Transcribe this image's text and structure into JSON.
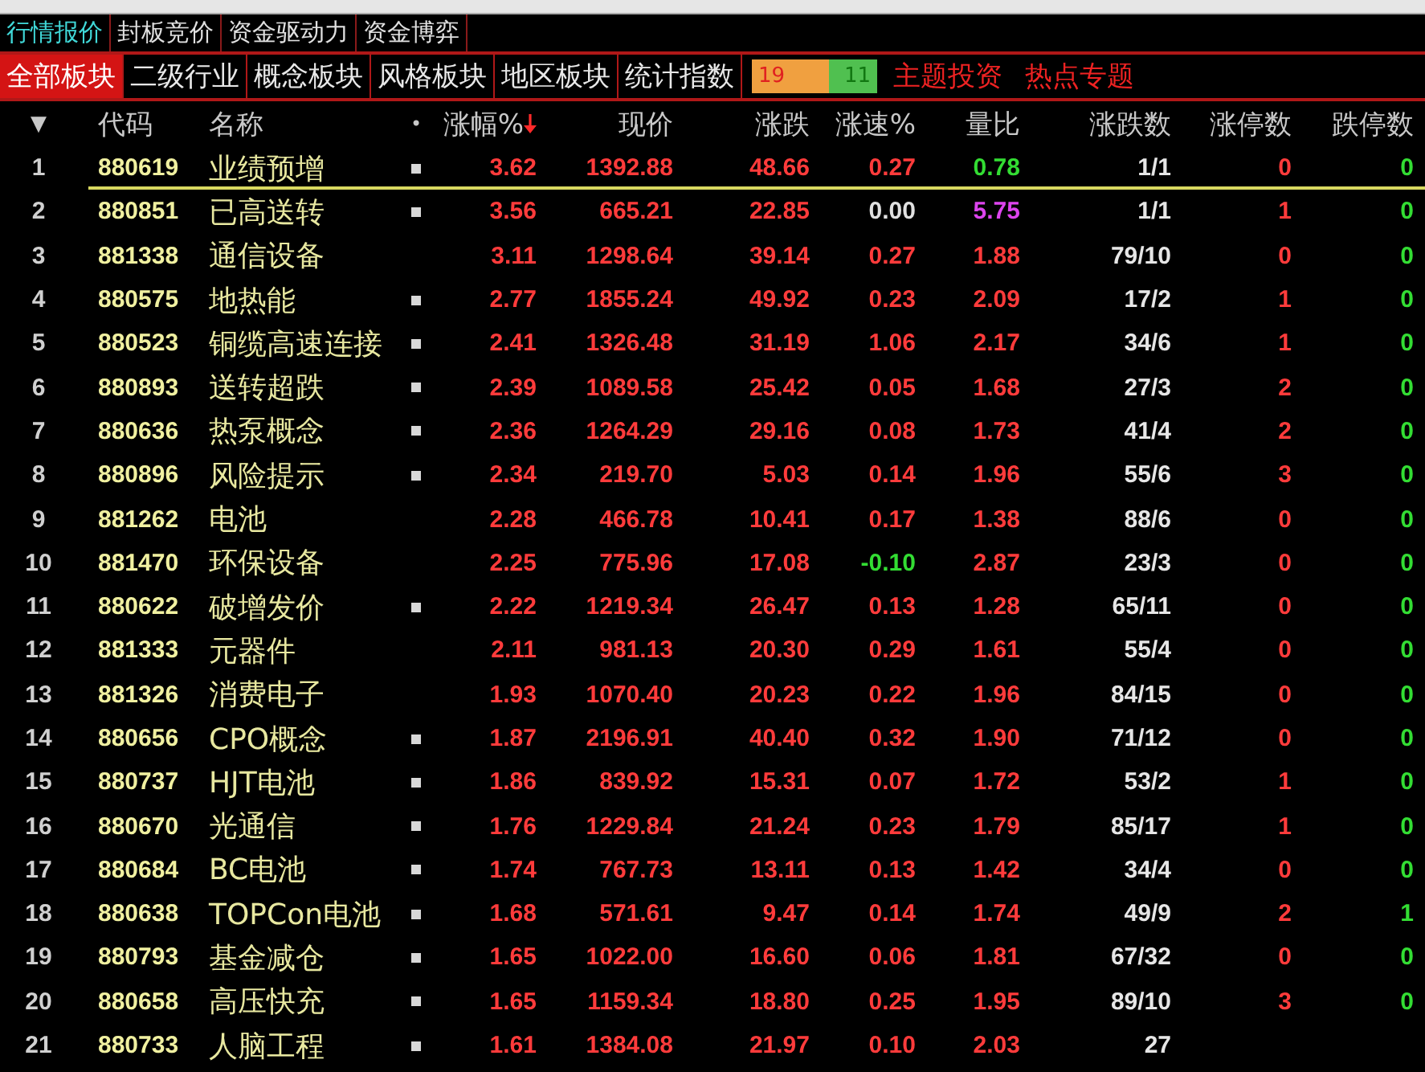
{
  "top_tabs": [
    {
      "label": "行情报价",
      "selected": true
    },
    {
      "label": "封板竞价",
      "selected": false
    },
    {
      "label": "资金驱动力",
      "selected": false
    },
    {
      "label": "资金博弈",
      "selected": false
    }
  ],
  "board_tabs": [
    {
      "label": "全部板块",
      "selected": true
    },
    {
      "label": "二级行业",
      "selected": false
    },
    {
      "label": "概念板块",
      "selected": false
    },
    {
      "label": "风格板块",
      "selected": false
    },
    {
      "label": "地区板块",
      "selected": false
    },
    {
      "label": "统计指数",
      "selected": false
    }
  ],
  "breadth": {
    "up": "19",
    "down": "11"
  },
  "links": [
    "主题投资",
    "热点专题"
  ],
  "columns": {
    "menu": "▼",
    "code": "代码",
    "name": "名称",
    "flag": "•",
    "change_pct": "涨幅%",
    "price": "现价",
    "change": "涨跌",
    "speed": "涨速%",
    "ratio": "量比",
    "up_down": "涨跌数",
    "limit_up": "涨停数",
    "limit_down": "跌停数"
  },
  "sort_descending": true,
  "rows": [
    {
      "no": "1",
      "code": "880619",
      "name": "业绩预增",
      "flagged": true,
      "selected": true,
      "change_pct": "3.62",
      "price": "1392.88",
      "change": "48.66",
      "speed": {
        "text": "0.27",
        "color": "#ff3b3b"
      },
      "ratio": {
        "text": "0.78",
        "color": "#33dd33"
      },
      "up_down": "1/1",
      "limit_up": "0",
      "limit_down": "0"
    },
    {
      "no": "2",
      "code": "880851",
      "name": "已高送转",
      "flagged": true,
      "selected": false,
      "change_pct": "3.56",
      "price": "665.21",
      "change": "22.85",
      "speed": {
        "text": "0.00",
        "color": "#e0e0e0"
      },
      "ratio": {
        "text": "5.75",
        "color": "#dd44ee"
      },
      "up_down": "1/1",
      "limit_up": "1",
      "limit_down": "0"
    },
    {
      "no": "3",
      "code": "881338",
      "name": "通信设备",
      "flagged": false,
      "selected": false,
      "change_pct": "3.11",
      "price": "1298.64",
      "change": "39.14",
      "speed": {
        "text": "0.27",
        "color": "#ff3b3b"
      },
      "ratio": {
        "text": "1.88",
        "color": "#ff3b3b"
      },
      "up_down": "79/10",
      "limit_up": "0",
      "limit_down": "0"
    },
    {
      "no": "4",
      "code": "880575",
      "name": "地热能",
      "flagged": true,
      "selected": false,
      "change_pct": "2.77",
      "price": "1855.24",
      "change": "49.92",
      "speed": {
        "text": "0.23",
        "color": "#ff3b3b"
      },
      "ratio": {
        "text": "2.09",
        "color": "#ff3b3b"
      },
      "up_down": "17/2",
      "limit_up": "1",
      "limit_down": "0"
    },
    {
      "no": "5",
      "code": "880523",
      "name": "铜缆高速连接",
      "flagged": true,
      "selected": false,
      "change_pct": "2.41",
      "price": "1326.48",
      "change": "31.19",
      "speed": {
        "text": "1.06",
        "color": "#ff3b3b"
      },
      "ratio": {
        "text": "2.17",
        "color": "#ff3b3b"
      },
      "up_down": "34/6",
      "limit_up": "1",
      "limit_down": "0"
    },
    {
      "no": "6",
      "code": "880893",
      "name": "送转超跌",
      "flagged": true,
      "selected": false,
      "change_pct": "2.39",
      "price": "1089.58",
      "change": "25.42",
      "speed": {
        "text": "0.05",
        "color": "#ff3b3b"
      },
      "ratio": {
        "text": "1.68",
        "color": "#ff3b3b"
      },
      "up_down": "27/3",
      "limit_up": "2",
      "limit_down": "0"
    },
    {
      "no": "7",
      "code": "880636",
      "name": "热泵概念",
      "flagged": true,
      "selected": false,
      "change_pct": "2.36",
      "price": "1264.29",
      "change": "29.16",
      "speed": {
        "text": "0.08",
        "color": "#ff3b3b"
      },
      "ratio": {
        "text": "1.73",
        "color": "#ff3b3b"
      },
      "up_down": "41/4",
      "limit_up": "2",
      "limit_down": "0"
    },
    {
      "no": "8",
      "code": "880896",
      "name": "风险提示",
      "flagged": true,
      "selected": false,
      "change_pct": "2.34",
      "price": "219.70",
      "change": "5.03",
      "speed": {
        "text": "0.14",
        "color": "#ff3b3b"
      },
      "ratio": {
        "text": "1.96",
        "color": "#ff3b3b"
      },
      "up_down": "55/6",
      "limit_up": "3",
      "limit_down": "0"
    },
    {
      "no": "9",
      "code": "881262",
      "name": "电池",
      "flagged": false,
      "selected": false,
      "change_pct": "2.28",
      "price": "466.78",
      "change": "10.41",
      "speed": {
        "text": "0.17",
        "color": "#ff3b3b"
      },
      "ratio": {
        "text": "1.38",
        "color": "#ff3b3b"
      },
      "up_down": "88/6",
      "limit_up": "0",
      "limit_down": "0"
    },
    {
      "no": "10",
      "code": "881470",
      "name": "环保设备",
      "flagged": false,
      "selected": false,
      "change_pct": "2.25",
      "price": "775.96",
      "change": "17.08",
      "speed": {
        "text": "-0.10",
        "color": "#33dd33"
      },
      "ratio": {
        "text": "2.87",
        "color": "#ff3b3b"
      },
      "up_down": "23/3",
      "limit_up": "0",
      "limit_down": "0"
    },
    {
      "no": "11",
      "code": "880622",
      "name": "破增发价",
      "flagged": true,
      "selected": false,
      "change_pct": "2.22",
      "price": "1219.34",
      "change": "26.47",
      "speed": {
        "text": "0.13",
        "color": "#ff3b3b"
      },
      "ratio": {
        "text": "1.28",
        "color": "#ff3b3b"
      },
      "up_down": "65/11",
      "limit_up": "0",
      "limit_down": "0"
    },
    {
      "no": "12",
      "code": "881333",
      "name": "元器件",
      "flagged": false,
      "selected": false,
      "change_pct": "2.11",
      "price": "981.13",
      "change": "20.30",
      "speed": {
        "text": "0.29",
        "color": "#ff3b3b"
      },
      "ratio": {
        "text": "1.61",
        "color": "#ff3b3b"
      },
      "up_down": "55/4",
      "limit_up": "0",
      "limit_down": "0"
    },
    {
      "no": "13",
      "code": "881326",
      "name": "消费电子",
      "flagged": false,
      "selected": false,
      "change_pct": "1.93",
      "price": "1070.40",
      "change": "20.23",
      "speed": {
        "text": "0.22",
        "color": "#ff3b3b"
      },
      "ratio": {
        "text": "1.96",
        "color": "#ff3b3b"
      },
      "up_down": "84/15",
      "limit_up": "0",
      "limit_down": "0"
    },
    {
      "no": "14",
      "code": "880656",
      "name": "CPO概念",
      "flagged": true,
      "selected": false,
      "change_pct": "1.87",
      "price": "2196.91",
      "change": "40.40",
      "speed": {
        "text": "0.32",
        "color": "#ff3b3b"
      },
      "ratio": {
        "text": "1.90",
        "color": "#ff3b3b"
      },
      "up_down": "71/12",
      "limit_up": "0",
      "limit_down": "0"
    },
    {
      "no": "15",
      "code": "880737",
      "name": "HJT电池",
      "flagged": true,
      "selected": false,
      "change_pct": "1.86",
      "price": "839.92",
      "change": "15.31",
      "speed": {
        "text": "0.07",
        "color": "#ff3b3b"
      },
      "ratio": {
        "text": "1.72",
        "color": "#ff3b3b"
      },
      "up_down": "53/2",
      "limit_up": "1",
      "limit_down": "0"
    },
    {
      "no": "16",
      "code": "880670",
      "name": "光通信",
      "flagged": true,
      "selected": false,
      "change_pct": "1.76",
      "price": "1229.84",
      "change": "21.24",
      "speed": {
        "text": "0.23",
        "color": "#ff3b3b"
      },
      "ratio": {
        "text": "1.79",
        "color": "#ff3b3b"
      },
      "up_down": "85/17",
      "limit_up": "1",
      "limit_down": "0"
    },
    {
      "no": "17",
      "code": "880684",
      "name": "BC电池",
      "flagged": true,
      "selected": false,
      "change_pct": "1.74",
      "price": "767.73",
      "change": "13.11",
      "speed": {
        "text": "0.13",
        "color": "#ff3b3b"
      },
      "ratio": {
        "text": "1.42",
        "color": "#ff3b3b"
      },
      "up_down": "34/4",
      "limit_up": "0",
      "limit_down": "0"
    },
    {
      "no": "18",
      "code": "880638",
      "name": "TOPCon电池",
      "flagged": true,
      "selected": false,
      "change_pct": "1.68",
      "price": "571.61",
      "change": "9.47",
      "speed": {
        "text": "0.14",
        "color": "#ff3b3b"
      },
      "ratio": {
        "text": "1.74",
        "color": "#ff3b3b"
      },
      "up_down": "49/9",
      "limit_up": "2",
      "limit_down": "1"
    },
    {
      "no": "19",
      "code": "880793",
      "name": "基金减仓",
      "flagged": true,
      "selected": false,
      "change_pct": "1.65",
      "price": "1022.00",
      "change": "16.60",
      "speed": {
        "text": "0.06",
        "color": "#ff3b3b"
      },
      "ratio": {
        "text": "1.81",
        "color": "#ff3b3b"
      },
      "up_down": "67/32",
      "limit_up": "0",
      "limit_down": "0"
    },
    {
      "no": "20",
      "code": "880658",
      "name": "高压快充",
      "flagged": true,
      "selected": false,
      "change_pct": "1.65",
      "price": "1159.34",
      "change": "18.80",
      "speed": {
        "text": "0.25",
        "color": "#ff3b3b"
      },
      "ratio": {
        "text": "1.95",
        "color": "#ff3b3b"
      },
      "up_down": "89/10",
      "limit_up": "3",
      "limit_down": "0"
    },
    {
      "no": "21",
      "code": "880733",
      "name": "人脑工程",
      "flagged": true,
      "selected": false,
      "change_pct": "1.61",
      "price": "1384.08",
      "change": "21.97",
      "speed": {
        "text": "0.10",
        "color": "#ff3b3b"
      },
      "ratio": {
        "text": "2.03",
        "color": "#ff3b3b"
      },
      "up_down": "27"
    }
  ]
}
